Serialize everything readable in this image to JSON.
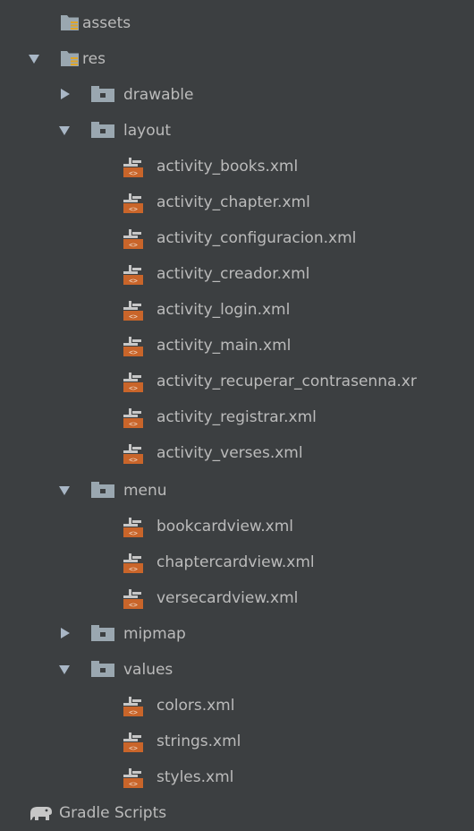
{
  "tree": {
    "assets": {
      "label": "assets",
      "icon": "resources-folder-icon"
    },
    "res": {
      "label": "res",
      "icon": "resources-folder-icon",
      "expanded": true
    },
    "drawable": {
      "label": "drawable",
      "icon": "folder-icon",
      "expanded": false
    },
    "layout": {
      "label": "layout",
      "icon": "folder-icon",
      "expanded": true,
      "files": [
        "activity_books.xml",
        "activity_chapter.xml",
        "activity_configuracion.xml",
        "activity_creador.xml",
        "activity_login.xml",
        "activity_main.xml",
        "activity_recuperar_contrasenna.xr",
        "activity_registrar.xml",
        "activity_verses.xml"
      ]
    },
    "menu": {
      "label": "menu",
      "icon": "folder-icon",
      "expanded": true,
      "files": [
        "bookcardview.xml",
        "chaptercardview.xml",
        "versecardview.xml"
      ]
    },
    "mipmap": {
      "label": "mipmap",
      "icon": "folder-icon",
      "expanded": false
    },
    "values": {
      "label": "values",
      "icon": "folder-icon",
      "expanded": true,
      "files": [
        "colors.xml",
        "strings.xml",
        "styles.xml"
      ]
    },
    "gradle": {
      "label": "Gradle Scripts",
      "icon": "gradle-elephant-icon"
    }
  },
  "colors": {
    "background": "#3c3f41",
    "text": "#bbbbbb",
    "folder": "#9aa7b0",
    "xml_icon_orange": "#c9652a"
  }
}
